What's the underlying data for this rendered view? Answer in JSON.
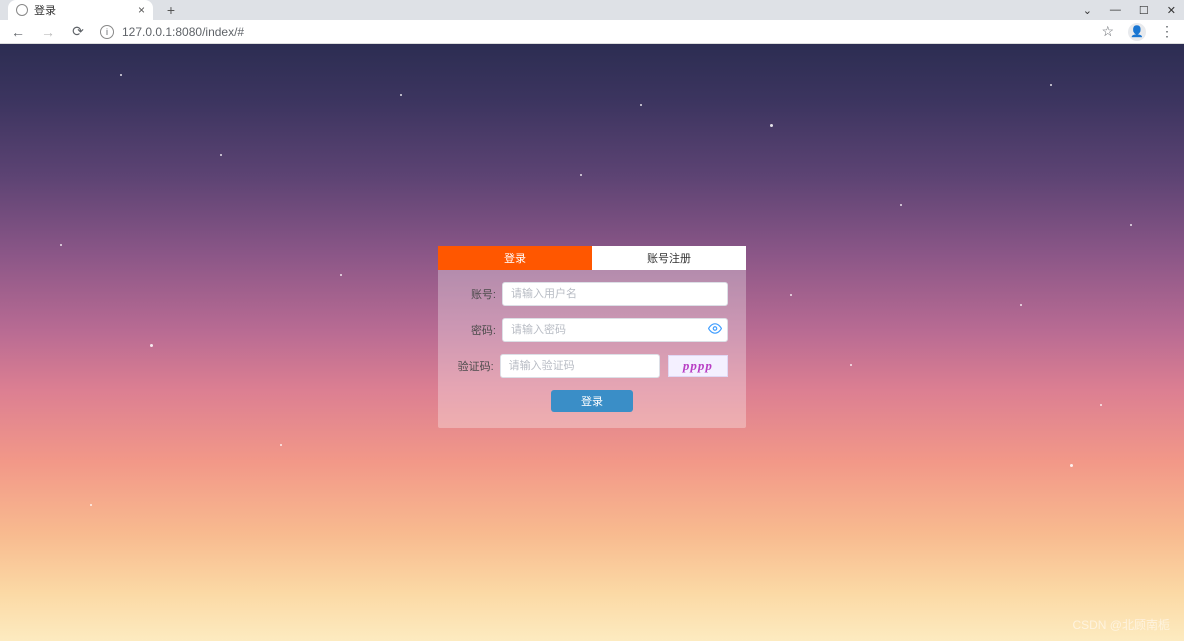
{
  "browser": {
    "tab_title": "登录",
    "url": "127.0.0.1:8080/index/#",
    "new_tab": "+",
    "close": "×",
    "window": {
      "min": "—",
      "max": "☐",
      "close": "✕",
      "down": "⌄"
    },
    "nav": {
      "back": "←",
      "forward": "→",
      "reload": "⟳"
    },
    "info": "ⓘ",
    "star": "☆",
    "avatar": "👤",
    "menu": "⋮"
  },
  "tabs": {
    "login": "登录",
    "register": "账号注册"
  },
  "form": {
    "username_label": "账号:",
    "username_placeholder": "请输入用户名",
    "password_label": "密码:",
    "password_placeholder": "请输入密码",
    "captcha_label": "验证码:",
    "captcha_placeholder": "请输入验证码",
    "captcha_text": "pppp",
    "submit": "登录"
  },
  "watermark": "CSDN @北顾南栀"
}
